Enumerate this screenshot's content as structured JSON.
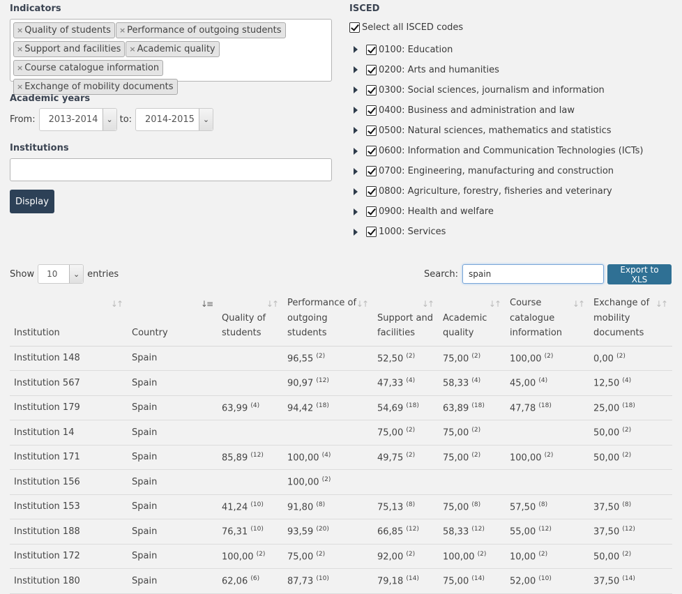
{
  "indicators": {
    "title": "Indicators",
    "selected": [
      "Quality of students",
      "Performance of outgoing students",
      "Support and facilities",
      "Academic quality",
      "Course catalogue information",
      "Exchange of mobility documents"
    ],
    "remove_glyph": "×"
  },
  "academic_years": {
    "title": "Academic years",
    "from_label": "From:",
    "from_value": "2013-2014",
    "to_label": "to:",
    "to_value": "2014-2015"
  },
  "institutions": {
    "title": "Institutions",
    "value": ""
  },
  "display_button": "Display",
  "isced": {
    "title": "ISCED",
    "select_all_label": "Select all ISCED codes",
    "select_all_checked": true,
    "items": [
      {
        "label": "0100: Education",
        "checked": true
      },
      {
        "label": "0200: Arts and humanities",
        "checked": true
      },
      {
        "label": "0300: Social sciences, journalism and information",
        "checked": true
      },
      {
        "label": "0400: Business and administration and law",
        "checked": true
      },
      {
        "label": "0500: Natural sciences, mathematics and statistics",
        "checked": true
      },
      {
        "label": "0600: Information and Communication Technologies (ICTs)",
        "checked": true
      },
      {
        "label": "0700: Engineering, manufacturing and construction",
        "checked": true
      },
      {
        "label": "0800: Agriculture, forestry, fisheries and veterinary",
        "checked": true
      },
      {
        "label": "0900: Health and welfare",
        "checked": true
      },
      {
        "label": "1000: Services",
        "checked": true
      }
    ]
  },
  "table_controls": {
    "show_label": "Show",
    "entries_value": "10",
    "entries_label": "entries",
    "search_label": "Search:",
    "search_value": "spain",
    "export_button": "Export to XLS"
  },
  "table": {
    "columns": [
      {
        "label": "Institution",
        "sort": "none"
      },
      {
        "label": "Country",
        "sort": "ascending"
      },
      {
        "label": "Quality of students",
        "sort": "none"
      },
      {
        "label": "Performance of outgoing students",
        "sort": "none"
      },
      {
        "label": "Support and facilities",
        "sort": "none"
      },
      {
        "label": "Academic quality",
        "sort": "none"
      },
      {
        "label": "Course catalogue information",
        "sort": "none"
      },
      {
        "label": "Exchange of mobility documents",
        "sort": "none"
      }
    ],
    "rows": [
      {
        "institution": "Institution 148",
        "country": "Spain",
        "cells": [
          null,
          [
            "96,55",
            "(2)"
          ],
          [
            "52,50",
            "(2)"
          ],
          [
            "75,00",
            "(2)"
          ],
          [
            "100,00",
            "(2)"
          ],
          [
            "0,00",
            "(2)"
          ]
        ]
      },
      {
        "institution": "Institution 567",
        "country": "Spain",
        "cells": [
          null,
          [
            "90,97",
            "(12)"
          ],
          [
            "47,33",
            "(4)"
          ],
          [
            "58,33",
            "(4)"
          ],
          [
            "45,00",
            "(4)"
          ],
          [
            "12,50",
            "(4)"
          ]
        ]
      },
      {
        "institution": "Institution 179",
        "country": "Spain",
        "cells": [
          [
            "63,99",
            "(4)"
          ],
          [
            "94,42",
            "(18)"
          ],
          [
            "54,69",
            "(18)"
          ],
          [
            "63,89",
            "(18)"
          ],
          [
            "47,78",
            "(18)"
          ],
          [
            "25,00",
            "(18)"
          ]
        ]
      },
      {
        "institution": "Institution 14",
        "country": "Spain",
        "cells": [
          null,
          null,
          [
            "75,00",
            "(2)"
          ],
          [
            "75,00",
            "(2)"
          ],
          null,
          [
            "50,00",
            "(2)"
          ]
        ]
      },
      {
        "institution": "Institution 171",
        "country": "Spain",
        "cells": [
          [
            "85,89",
            "(12)"
          ],
          [
            "100,00",
            "(4)"
          ],
          [
            "49,75",
            "(2)"
          ],
          [
            "75,00",
            "(2)"
          ],
          [
            "100,00",
            "(2)"
          ],
          [
            "50,00",
            "(2)"
          ]
        ]
      },
      {
        "institution": "Institution 156",
        "country": "Spain",
        "cells": [
          null,
          [
            "100,00",
            "(2)"
          ],
          null,
          null,
          null,
          null
        ]
      },
      {
        "institution": "Institution 153",
        "country": "Spain",
        "cells": [
          [
            "41,24",
            "(10)"
          ],
          [
            "91,80",
            "(8)"
          ],
          [
            "75,13",
            "(8)"
          ],
          [
            "75,00",
            "(8)"
          ],
          [
            "57,50",
            "(8)"
          ],
          [
            "37,50",
            "(8)"
          ]
        ]
      },
      {
        "institution": "Institution 188",
        "country": "Spain",
        "cells": [
          [
            "76,31",
            "(10)"
          ],
          [
            "93,59",
            "(20)"
          ],
          [
            "66,85",
            "(12)"
          ],
          [
            "58,33",
            "(12)"
          ],
          [
            "55,00",
            "(12)"
          ],
          [
            "37,50",
            "(12)"
          ]
        ]
      },
      {
        "institution": "Institution 172",
        "country": "Spain",
        "cells": [
          [
            "100,00",
            "(2)"
          ],
          [
            "75,00",
            "(2)"
          ],
          [
            "92,00",
            "(2)"
          ],
          [
            "100,00",
            "(2)"
          ],
          [
            "10,00",
            "(2)"
          ],
          [
            "50,00",
            "(2)"
          ]
        ]
      },
      {
        "institution": "Institution 180",
        "country": "Spain",
        "cells": [
          [
            "62,06",
            "(6)"
          ],
          [
            "87,73",
            "(10)"
          ],
          [
            "79,18",
            "(14)"
          ],
          [
            "75,00",
            "(14)"
          ],
          [
            "52,00",
            "(10)"
          ],
          [
            "37,50",
            "(14)"
          ]
        ]
      }
    ]
  }
}
